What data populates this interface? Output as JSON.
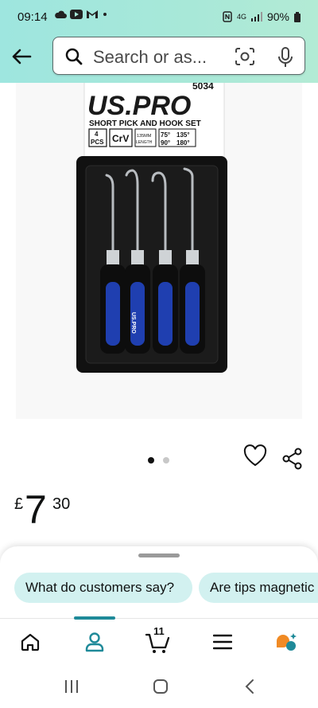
{
  "status_bar": {
    "time": "09:14",
    "battery": "90%",
    "network": "4G"
  },
  "header": {
    "search_placeholder": "Search or as...",
    "icons": [
      "back-arrow-icon",
      "search-icon",
      "camera-scan-icon",
      "mic-icon"
    ]
  },
  "product_image": {
    "model_number": "5034",
    "brand": "US.PRO",
    "product_name": "SHORT PICK AND HOOK SET",
    "badge_pieces_number": "4",
    "badge_pieces_label": "PCS",
    "badge_material": "CrV",
    "badge_length": "135MM",
    "badge_length_label": "LENGTH",
    "angles": [
      "75°",
      "135°",
      "90°",
      "180°"
    ],
    "handle_brand": "US.PRO"
  },
  "carousel": {
    "current": 1,
    "total": 2
  },
  "price": {
    "currency": "£",
    "whole": "7",
    "fraction": "30"
  },
  "suggestions": [
    "What do customers say?",
    "Are tips magnetic"
  ],
  "bottom_nav": {
    "cart_count": "11",
    "items": [
      "home-icon",
      "account-icon",
      "cart-icon",
      "menu-icon",
      "rufus-icon"
    ],
    "active_index": 1
  },
  "colors": {
    "header_gradient": "#a8e8d8",
    "chip_bg": "#d2f1f0",
    "accent": "#1f8a99",
    "handle_blue": "#1f3fb0"
  }
}
